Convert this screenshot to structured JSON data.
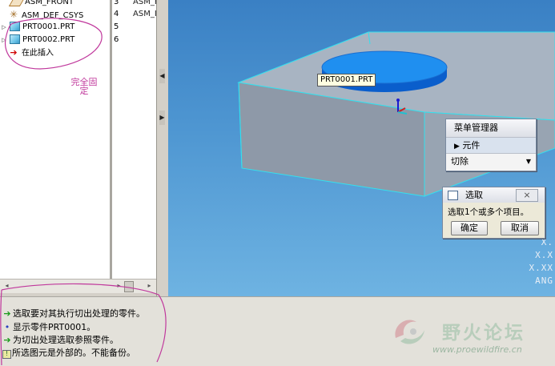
{
  "model_tree": {
    "items": [
      {
        "label": "ASM_FRONT",
        "num": "3",
        "col": "ASM_F"
      },
      {
        "label": "ASM_DEF_CSYS",
        "num": "4",
        "col": "ASM_I"
      },
      {
        "label": "PRT0001.PRT",
        "num": "5",
        "col": ""
      },
      {
        "label": "PRT0002.PRT",
        "num": "6",
        "col": ""
      },
      {
        "label": "在此插入",
        "num": "",
        "col": ""
      }
    ],
    "annotation": "完全固定"
  },
  "viewport": {
    "tooltip": "PRT0001.PRT",
    "readout": [
      "X.",
      "X.X",
      "X.XX",
      "ANG"
    ]
  },
  "menu_manager": {
    "title": "菜单管理器",
    "item": "元件",
    "select_value": "切除"
  },
  "select_dialog": {
    "title": "选取",
    "prompt": "选取1个或多个项目。",
    "ok_label": "确定",
    "cancel_label": "取消"
  },
  "messages": [
    "选取要对其执行切出处理的零件。",
    "显示零件PRT0001。",
    "为切出处理选取参照零件。",
    "所选图元是外部的。不能备份。"
  ],
  "watermark": {
    "name": "野火论坛",
    "url": "www.proewildfire.cn"
  }
}
